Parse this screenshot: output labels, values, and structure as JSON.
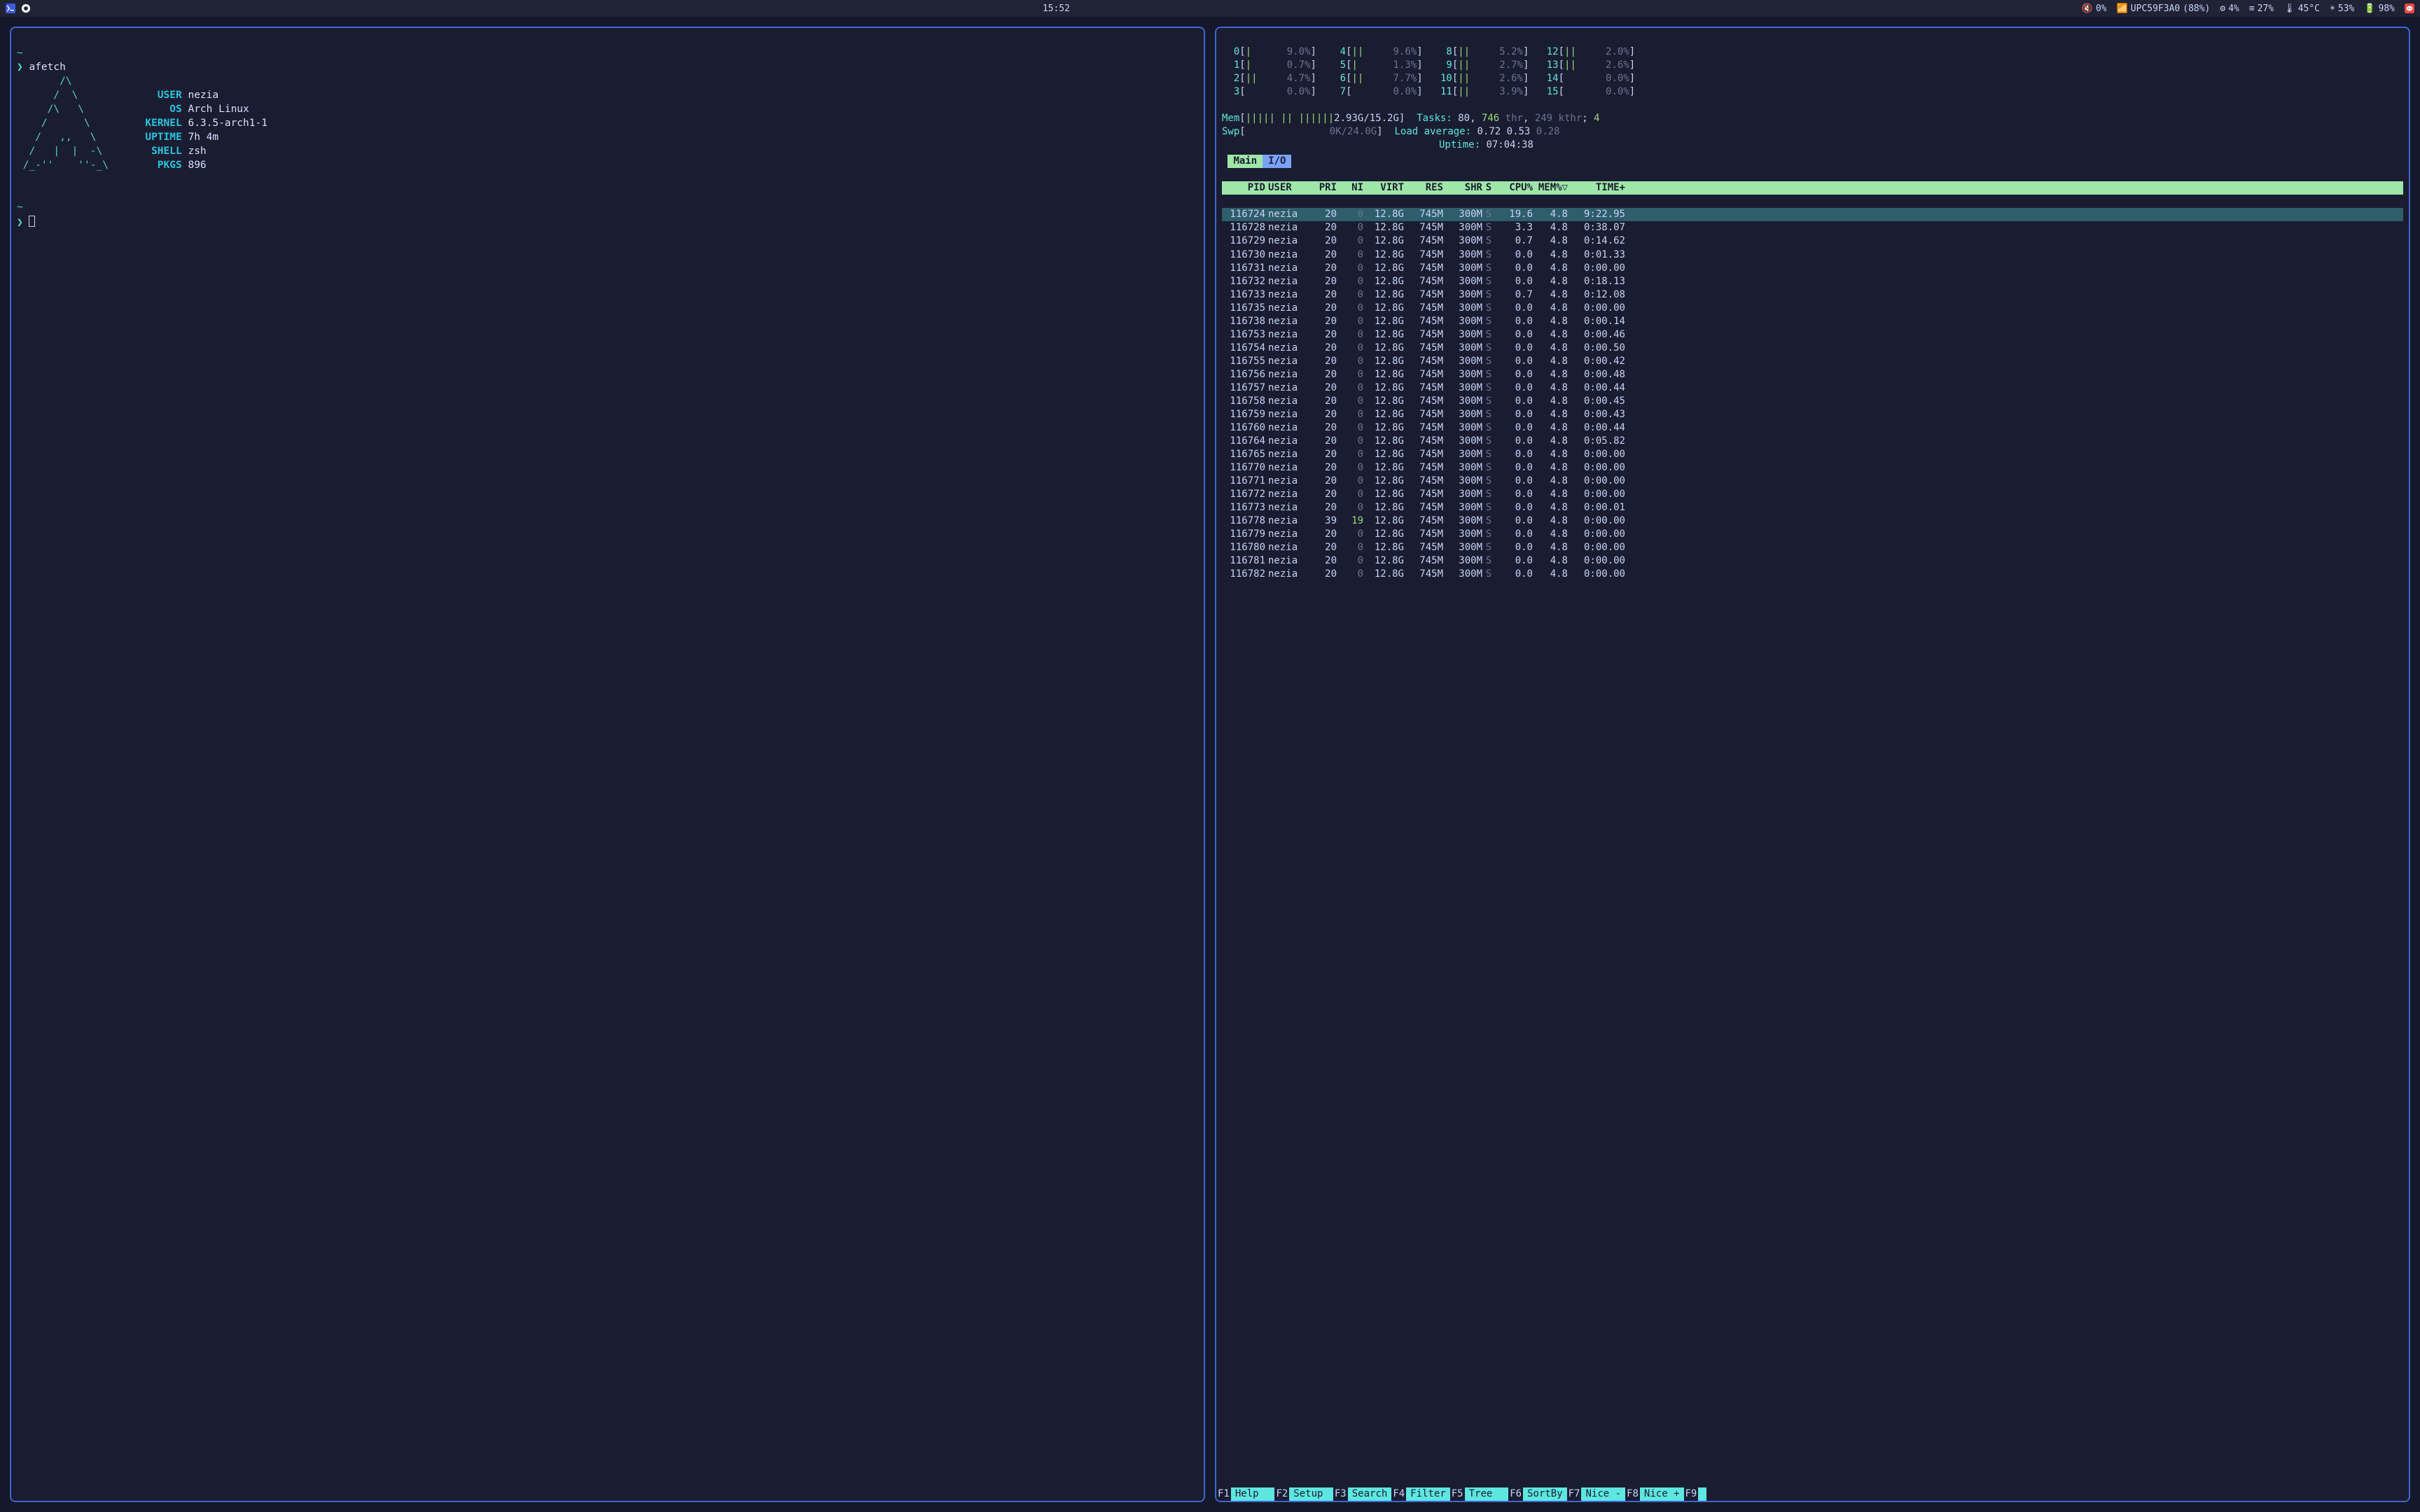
{
  "taskbar": {
    "clock": "15:52",
    "volume_pct": "0%",
    "wifi_ssid": "UPC59F3A0",
    "wifi_pct": "(88%)",
    "gear_pct": "4%",
    "ram_pct": "27%",
    "temp": "45°C",
    "brightness_pct": "53%",
    "battery_pct": "98%"
  },
  "left_terminal": {
    "prompt": "❯",
    "command": "afetch",
    "logo": [
      "       /\\",
      "      /  \\",
      "     /\\   \\",
      "    /      \\",
      "   /   ,,   \\",
      "  /   |  |  -\\",
      " /_-''    ''-_\\"
    ],
    "fields": {
      "user_k": "USER",
      "user_v": "nezia",
      "os_k": "OS",
      "os_v": "Arch Linux",
      "kernel_k": "KERNEL",
      "kernel_v": "6.3.5-arch1-1",
      "uptime_k": "UPTIME",
      "uptime_v": "7h 4m",
      "shell_k": "SHELL",
      "shell_v": "zsh",
      "pkgs_k": "PKGS",
      "pkgs_v": "896"
    },
    "tilde": "~"
  },
  "htop": {
    "cpu": [
      {
        "n": "0",
        "bar": "|",
        "pct": "9.0%"
      },
      {
        "n": "4",
        "bar": "||",
        "pct": "9.6%"
      },
      {
        "n": "8",
        "bar": "||",
        "pct": "5.2%"
      },
      {
        "n": "12",
        "bar": "||",
        "pct": "2.0%"
      },
      {
        "n": "1",
        "bar": "|",
        "pct": "0.7%"
      },
      {
        "n": "5",
        "bar": "|",
        "pct": "1.3%"
      },
      {
        "n": "9",
        "bar": "||",
        "pct": "2.7%"
      },
      {
        "n": "13",
        "bar": "||",
        "pct": "2.6%"
      },
      {
        "n": "2",
        "bar": "||",
        "pct": "4.7%"
      },
      {
        "n": "6",
        "bar": "||",
        "pct": "7.7%"
      },
      {
        "n": "10",
        "bar": "||",
        "pct": "2.6%"
      },
      {
        "n": "14",
        "bar": "",
        "pct": "0.0%"
      },
      {
        "n": "3",
        "bar": "",
        "pct": "0.0%"
      },
      {
        "n": "7",
        "bar": "",
        "pct": "0.0%"
      },
      {
        "n": "11",
        "bar": "||",
        "pct": "3.9%"
      },
      {
        "n": "15",
        "bar": "",
        "pct": "0.0%"
      }
    ],
    "mem_label": "Mem",
    "mem_bar": "||||| || ||||||",
    "mem_text": "2.93G/15.2G",
    "swp_label": "Swp",
    "swp_text": "0K/24.0G",
    "tasks_label": "Tasks:",
    "tasks_procs": "80",
    "tasks_thr": "746",
    "tasks_thr_suffix": "thr",
    "tasks_kthr": "249",
    "tasks_kthr_suffix": "kthr",
    "tasks_running": "4",
    "load_label": "Load average:",
    "load1": "0.72",
    "load2": "0.53",
    "load3": "0.28",
    "uptime_label": "Uptime:",
    "uptime": "07:04:38",
    "tab_main": "Main",
    "tab_io": "I/O",
    "header": {
      "pid": "PID",
      "user": "USER",
      "pri": "PRI",
      "ni": "NI",
      "virt": "VIRT",
      "res": "RES",
      "shr": "SHR",
      "s": "S",
      "cpu": "CPU%",
      "mem": "MEM%▽",
      "time": "TIME+"
    },
    "rows": [
      {
        "pid": "116724",
        "user": "nezia",
        "pri": "20",
        "ni": "0",
        "virt": "12.8G",
        "res": "745M",
        "shr": "300M",
        "s": "S",
        "cpu": "19.6",
        "mem": "4.8",
        "time": "9:22.95",
        "sel": true
      },
      {
        "pid": "116728",
        "user": "nezia",
        "pri": "20",
        "ni": "0",
        "virt": "12.8G",
        "res": "745M",
        "shr": "300M",
        "s": "S",
        "cpu": "3.3",
        "mem": "4.8",
        "time": "0:38.07"
      },
      {
        "pid": "116729",
        "user": "nezia",
        "pri": "20",
        "ni": "0",
        "virt": "12.8G",
        "res": "745M",
        "shr": "300M",
        "s": "S",
        "cpu": "0.7",
        "mem": "4.8",
        "time": "0:14.62"
      },
      {
        "pid": "116730",
        "user": "nezia",
        "pri": "20",
        "ni": "0",
        "virt": "12.8G",
        "res": "745M",
        "shr": "300M",
        "s": "S",
        "cpu": "0.0",
        "mem": "4.8",
        "time": "0:01.33"
      },
      {
        "pid": "116731",
        "user": "nezia",
        "pri": "20",
        "ni": "0",
        "virt": "12.8G",
        "res": "745M",
        "shr": "300M",
        "s": "S",
        "cpu": "0.0",
        "mem": "4.8",
        "time": "0:00.00"
      },
      {
        "pid": "116732",
        "user": "nezia",
        "pri": "20",
        "ni": "0",
        "virt": "12.8G",
        "res": "745M",
        "shr": "300M",
        "s": "S",
        "cpu": "0.0",
        "mem": "4.8",
        "time": "0:18.13"
      },
      {
        "pid": "116733",
        "user": "nezia",
        "pri": "20",
        "ni": "0",
        "virt": "12.8G",
        "res": "745M",
        "shr": "300M",
        "s": "S",
        "cpu": "0.7",
        "mem": "4.8",
        "time": "0:12.08"
      },
      {
        "pid": "116735",
        "user": "nezia",
        "pri": "20",
        "ni": "0",
        "virt": "12.8G",
        "res": "745M",
        "shr": "300M",
        "s": "S",
        "cpu": "0.0",
        "mem": "4.8",
        "time": "0:00.00"
      },
      {
        "pid": "116738",
        "user": "nezia",
        "pri": "20",
        "ni": "0",
        "virt": "12.8G",
        "res": "745M",
        "shr": "300M",
        "s": "S",
        "cpu": "0.0",
        "mem": "4.8",
        "time": "0:00.14"
      },
      {
        "pid": "116753",
        "user": "nezia",
        "pri": "20",
        "ni": "0",
        "virt": "12.8G",
        "res": "745M",
        "shr": "300M",
        "s": "S",
        "cpu": "0.0",
        "mem": "4.8",
        "time": "0:00.46"
      },
      {
        "pid": "116754",
        "user": "nezia",
        "pri": "20",
        "ni": "0",
        "virt": "12.8G",
        "res": "745M",
        "shr": "300M",
        "s": "S",
        "cpu": "0.0",
        "mem": "4.8",
        "time": "0:00.50"
      },
      {
        "pid": "116755",
        "user": "nezia",
        "pri": "20",
        "ni": "0",
        "virt": "12.8G",
        "res": "745M",
        "shr": "300M",
        "s": "S",
        "cpu": "0.0",
        "mem": "4.8",
        "time": "0:00.42"
      },
      {
        "pid": "116756",
        "user": "nezia",
        "pri": "20",
        "ni": "0",
        "virt": "12.8G",
        "res": "745M",
        "shr": "300M",
        "s": "S",
        "cpu": "0.0",
        "mem": "4.8",
        "time": "0:00.48"
      },
      {
        "pid": "116757",
        "user": "nezia",
        "pri": "20",
        "ni": "0",
        "virt": "12.8G",
        "res": "745M",
        "shr": "300M",
        "s": "S",
        "cpu": "0.0",
        "mem": "4.8",
        "time": "0:00.44"
      },
      {
        "pid": "116758",
        "user": "nezia",
        "pri": "20",
        "ni": "0",
        "virt": "12.8G",
        "res": "745M",
        "shr": "300M",
        "s": "S",
        "cpu": "0.0",
        "mem": "4.8",
        "time": "0:00.45"
      },
      {
        "pid": "116759",
        "user": "nezia",
        "pri": "20",
        "ni": "0",
        "virt": "12.8G",
        "res": "745M",
        "shr": "300M",
        "s": "S",
        "cpu": "0.0",
        "mem": "4.8",
        "time": "0:00.43"
      },
      {
        "pid": "116760",
        "user": "nezia",
        "pri": "20",
        "ni": "0",
        "virt": "12.8G",
        "res": "745M",
        "shr": "300M",
        "s": "S",
        "cpu": "0.0",
        "mem": "4.8",
        "time": "0:00.44"
      },
      {
        "pid": "116764",
        "user": "nezia",
        "pri": "20",
        "ni": "0",
        "virt": "12.8G",
        "res": "745M",
        "shr": "300M",
        "s": "S",
        "cpu": "0.0",
        "mem": "4.8",
        "time": "0:05.82"
      },
      {
        "pid": "116765",
        "user": "nezia",
        "pri": "20",
        "ni": "0",
        "virt": "12.8G",
        "res": "745M",
        "shr": "300M",
        "s": "S",
        "cpu": "0.0",
        "mem": "4.8",
        "time": "0:00.00"
      },
      {
        "pid": "116770",
        "user": "nezia",
        "pri": "20",
        "ni": "0",
        "virt": "12.8G",
        "res": "745M",
        "shr": "300M",
        "s": "S",
        "cpu": "0.0",
        "mem": "4.8",
        "time": "0:00.00"
      },
      {
        "pid": "116771",
        "user": "nezia",
        "pri": "20",
        "ni": "0",
        "virt": "12.8G",
        "res": "745M",
        "shr": "300M",
        "s": "S",
        "cpu": "0.0",
        "mem": "4.8",
        "time": "0:00.00"
      },
      {
        "pid": "116772",
        "user": "nezia",
        "pri": "20",
        "ni": "0",
        "virt": "12.8G",
        "res": "745M",
        "shr": "300M",
        "s": "S",
        "cpu": "0.0",
        "mem": "4.8",
        "time": "0:00.00"
      },
      {
        "pid": "116773",
        "user": "nezia",
        "pri": "20",
        "ni": "0",
        "virt": "12.8G",
        "res": "745M",
        "shr": "300M",
        "s": "S",
        "cpu": "0.0",
        "mem": "4.8",
        "time": "0:00.01"
      },
      {
        "pid": "116778",
        "user": "nezia",
        "pri": "39",
        "ni": "19",
        "virt": "12.8G",
        "res": "745M",
        "shr": "300M",
        "s": "S",
        "cpu": "0.0",
        "mem": "4.8",
        "time": "0:00.00"
      },
      {
        "pid": "116779",
        "user": "nezia",
        "pri": "20",
        "ni": "0",
        "virt": "12.8G",
        "res": "745M",
        "shr": "300M",
        "s": "S",
        "cpu": "0.0",
        "mem": "4.8",
        "time": "0:00.00"
      },
      {
        "pid": "116780",
        "user": "nezia",
        "pri": "20",
        "ni": "0",
        "virt": "12.8G",
        "res": "745M",
        "shr": "300M",
        "s": "S",
        "cpu": "0.0",
        "mem": "4.8",
        "time": "0:00.00"
      },
      {
        "pid": "116781",
        "user": "nezia",
        "pri": "20",
        "ni": "0",
        "virt": "12.8G",
        "res": "745M",
        "shr": "300M",
        "s": "S",
        "cpu": "0.0",
        "mem": "4.8",
        "time": "0:00.00"
      },
      {
        "pid": "116782",
        "user": "nezia",
        "pri": "20",
        "ni": "0",
        "virt": "12.8G",
        "res": "745M",
        "shr": "300M",
        "s": "S",
        "cpu": "0.0",
        "mem": "4.8",
        "time": "0:00.00"
      }
    ],
    "fkeys": [
      {
        "k": "F1",
        "l": "Help  "
      },
      {
        "k": "F2",
        "l": "Setup "
      },
      {
        "k": "F3",
        "l": "Search"
      },
      {
        "k": "F4",
        "l": "Filter"
      },
      {
        "k": "F5",
        "l": "Tree  "
      },
      {
        "k": "F6",
        "l": "SortBy"
      },
      {
        "k": "F7",
        "l": "Nice -"
      },
      {
        "k": "F8",
        "l": "Nice +"
      },
      {
        "k": "F9",
        "l": ""
      }
    ]
  }
}
